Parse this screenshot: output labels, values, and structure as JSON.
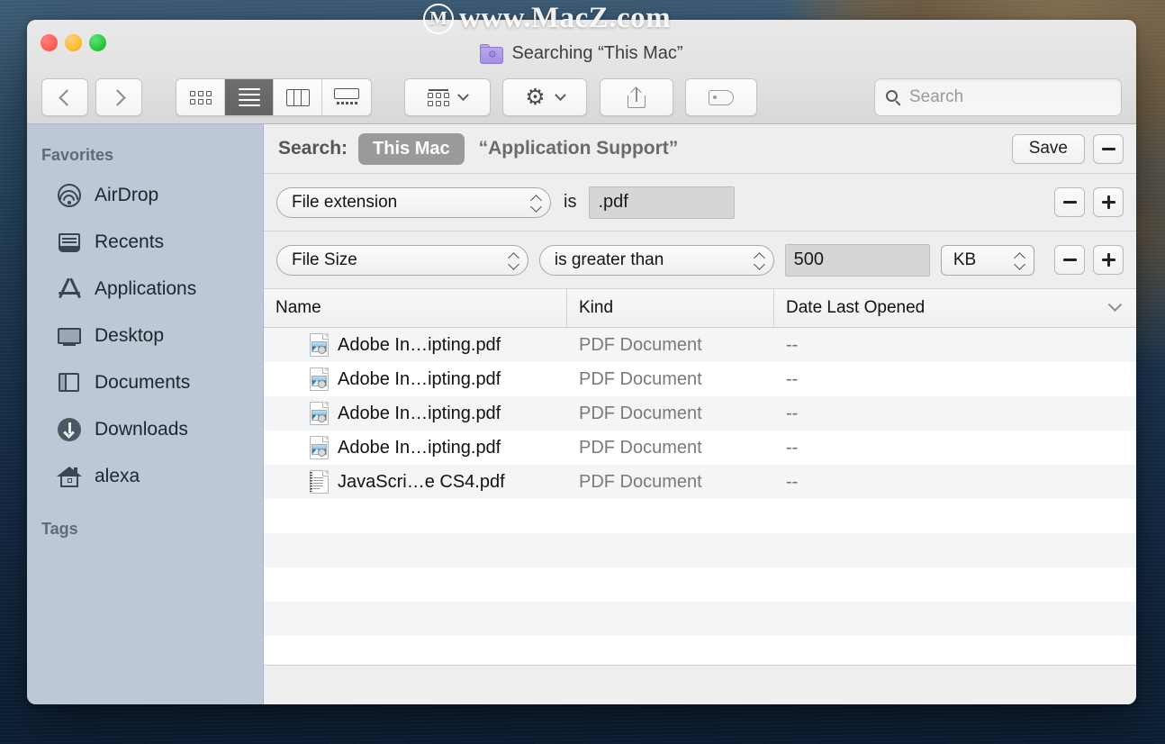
{
  "watermark": {
    "logo_letter": "M",
    "text": "www.MacZ.com"
  },
  "window": {
    "title": "Searching “This Mac”",
    "title_icon": "smart-folder-icon"
  },
  "toolbar": {
    "back_icon": "chevron-left-icon",
    "forward_icon": "chevron-right-icon",
    "view_modes": [
      {
        "name": "icon-view",
        "icon": "grid-icon",
        "active": false
      },
      {
        "name": "list-view",
        "icon": "list-icon",
        "active": true
      },
      {
        "name": "column-view",
        "icon": "columns-icon",
        "active": false
      },
      {
        "name": "gallery-view",
        "icon": "gallery-icon",
        "active": false
      }
    ],
    "group_icon": "group-by-icon",
    "group_chevron": "chevron-down-icon",
    "action_icon": "gear-icon",
    "action_chevron": "chevron-down-icon",
    "share_icon": "share-icon",
    "tag_icon": "tag-icon"
  },
  "search": {
    "placeholder": "Search",
    "value": "",
    "icon": "search-icon"
  },
  "sidebar": {
    "sections": [
      {
        "header": "Favorites",
        "items": [
          {
            "label": "AirDrop",
            "icon": "airdrop-icon"
          },
          {
            "label": "Recents",
            "icon": "recents-icon"
          },
          {
            "label": "Applications",
            "icon": "applications-icon"
          },
          {
            "label": "Desktop",
            "icon": "desktop-icon"
          },
          {
            "label": "Documents",
            "icon": "documents-icon"
          },
          {
            "label": "Downloads",
            "icon": "downloads-icon"
          },
          {
            "label": "alexa",
            "icon": "home-icon"
          }
        ]
      },
      {
        "header": "Tags",
        "items": []
      }
    ]
  },
  "scope_bar": {
    "label": "Search:",
    "scope_selected": "This Mac",
    "search_term": "“Application Support”",
    "save_label": "Save",
    "remove_icon": "minus-icon"
  },
  "criteria": [
    {
      "attribute": "File extension",
      "operator": "is",
      "operator_is_popup": false,
      "value": ".pdf",
      "unit": null,
      "remove_icon": "minus-icon",
      "add_icon": "plus-icon"
    },
    {
      "attribute": "File Size",
      "operator": "is greater than",
      "operator_is_popup": true,
      "value": "500",
      "unit": "KB",
      "remove_icon": "minus-icon",
      "add_icon": "plus-icon"
    }
  ],
  "columns": [
    {
      "key": "name",
      "label": "Name"
    },
    {
      "key": "kind",
      "label": "Kind"
    },
    {
      "key": "date",
      "label": "Date Last Opened",
      "sort_icon": "chevron-down-icon"
    }
  ],
  "files": [
    {
      "name": "Adobe In…ipting.pdf",
      "kind": "PDF Document",
      "date": "--",
      "icon": "pdf-photo-icon"
    },
    {
      "name": "Adobe In…ipting.pdf",
      "kind": "PDF Document",
      "date": "--",
      "icon": "pdf-photo-icon"
    },
    {
      "name": "Adobe In…ipting.pdf",
      "kind": "PDF Document",
      "date": "--",
      "icon": "pdf-photo-icon"
    },
    {
      "name": "Adobe In…ipting.pdf",
      "kind": "PDF Document",
      "date": "--",
      "icon": "pdf-photo-icon"
    },
    {
      "name": "JavaScri…e CS4.pdf",
      "kind": "PDF Document",
      "date": "--",
      "icon": "pdf-text-icon"
    }
  ],
  "colors": {
    "sidebar_bg": "#bcc8d6",
    "scope_pill": "#9a9a9a",
    "active_segment": "#6e6e6e",
    "row_alt": "#f4f5f6",
    "smart_folder": "#b9a7ec"
  }
}
